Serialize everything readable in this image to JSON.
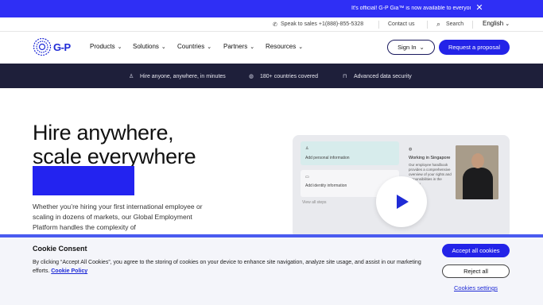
{
  "announcement": {
    "text": "It's official! G-P Gia™ is now available to everyone",
    "close_icon": "close-icon"
  },
  "utility": {
    "phone_label": "Speak to sales +1(888)-855-5328",
    "contact": "Contact us",
    "search": "Search",
    "language": "English"
  },
  "brand": {
    "logo_text": "G-P"
  },
  "nav": {
    "items": [
      "Products",
      "Solutions",
      "Countries",
      "Partners",
      "Resources"
    ],
    "signin": "Sign In",
    "proposal": "Request a proposal"
  },
  "features": [
    {
      "icon": "person-icon",
      "label": "Hire anyone, anywhere, in minutes"
    },
    {
      "icon": "globe-icon",
      "label": "180+ countries covered"
    },
    {
      "icon": "lock-icon",
      "label": "Advanced data security"
    }
  ],
  "hero": {
    "title_line1": "Hire anywhere,",
    "title_line2": "scale everywhere",
    "description": "Whether you’re hiring your first international employee or scaling in dozens of markets, our Global Employment Platform handles the complexity of"
  },
  "video": {
    "field1": "Add personal information",
    "field2": "Add identity information",
    "small_link": "View all steps",
    "card_title": "Working in Singapore",
    "card_text": "Our employee handbook provides a comprehensive overview of your rights and responsibilities in the country"
  },
  "cookie": {
    "title": "Cookie Consent",
    "text": "By clicking “Accept All Cookies”, you agree to the storing of cookies on your device to enhance site navigation, analyze site usage, and assist in our marketing efforts.",
    "policy_link": "Cookie Policy",
    "accept": "Accept all cookies",
    "reject": "Reject all",
    "settings": "Cookies settings"
  },
  "colors": {
    "brand_blue": "#2323e8",
    "navy_bar": "#1e1f3a",
    "announce_blue": "#2f2ff5"
  }
}
